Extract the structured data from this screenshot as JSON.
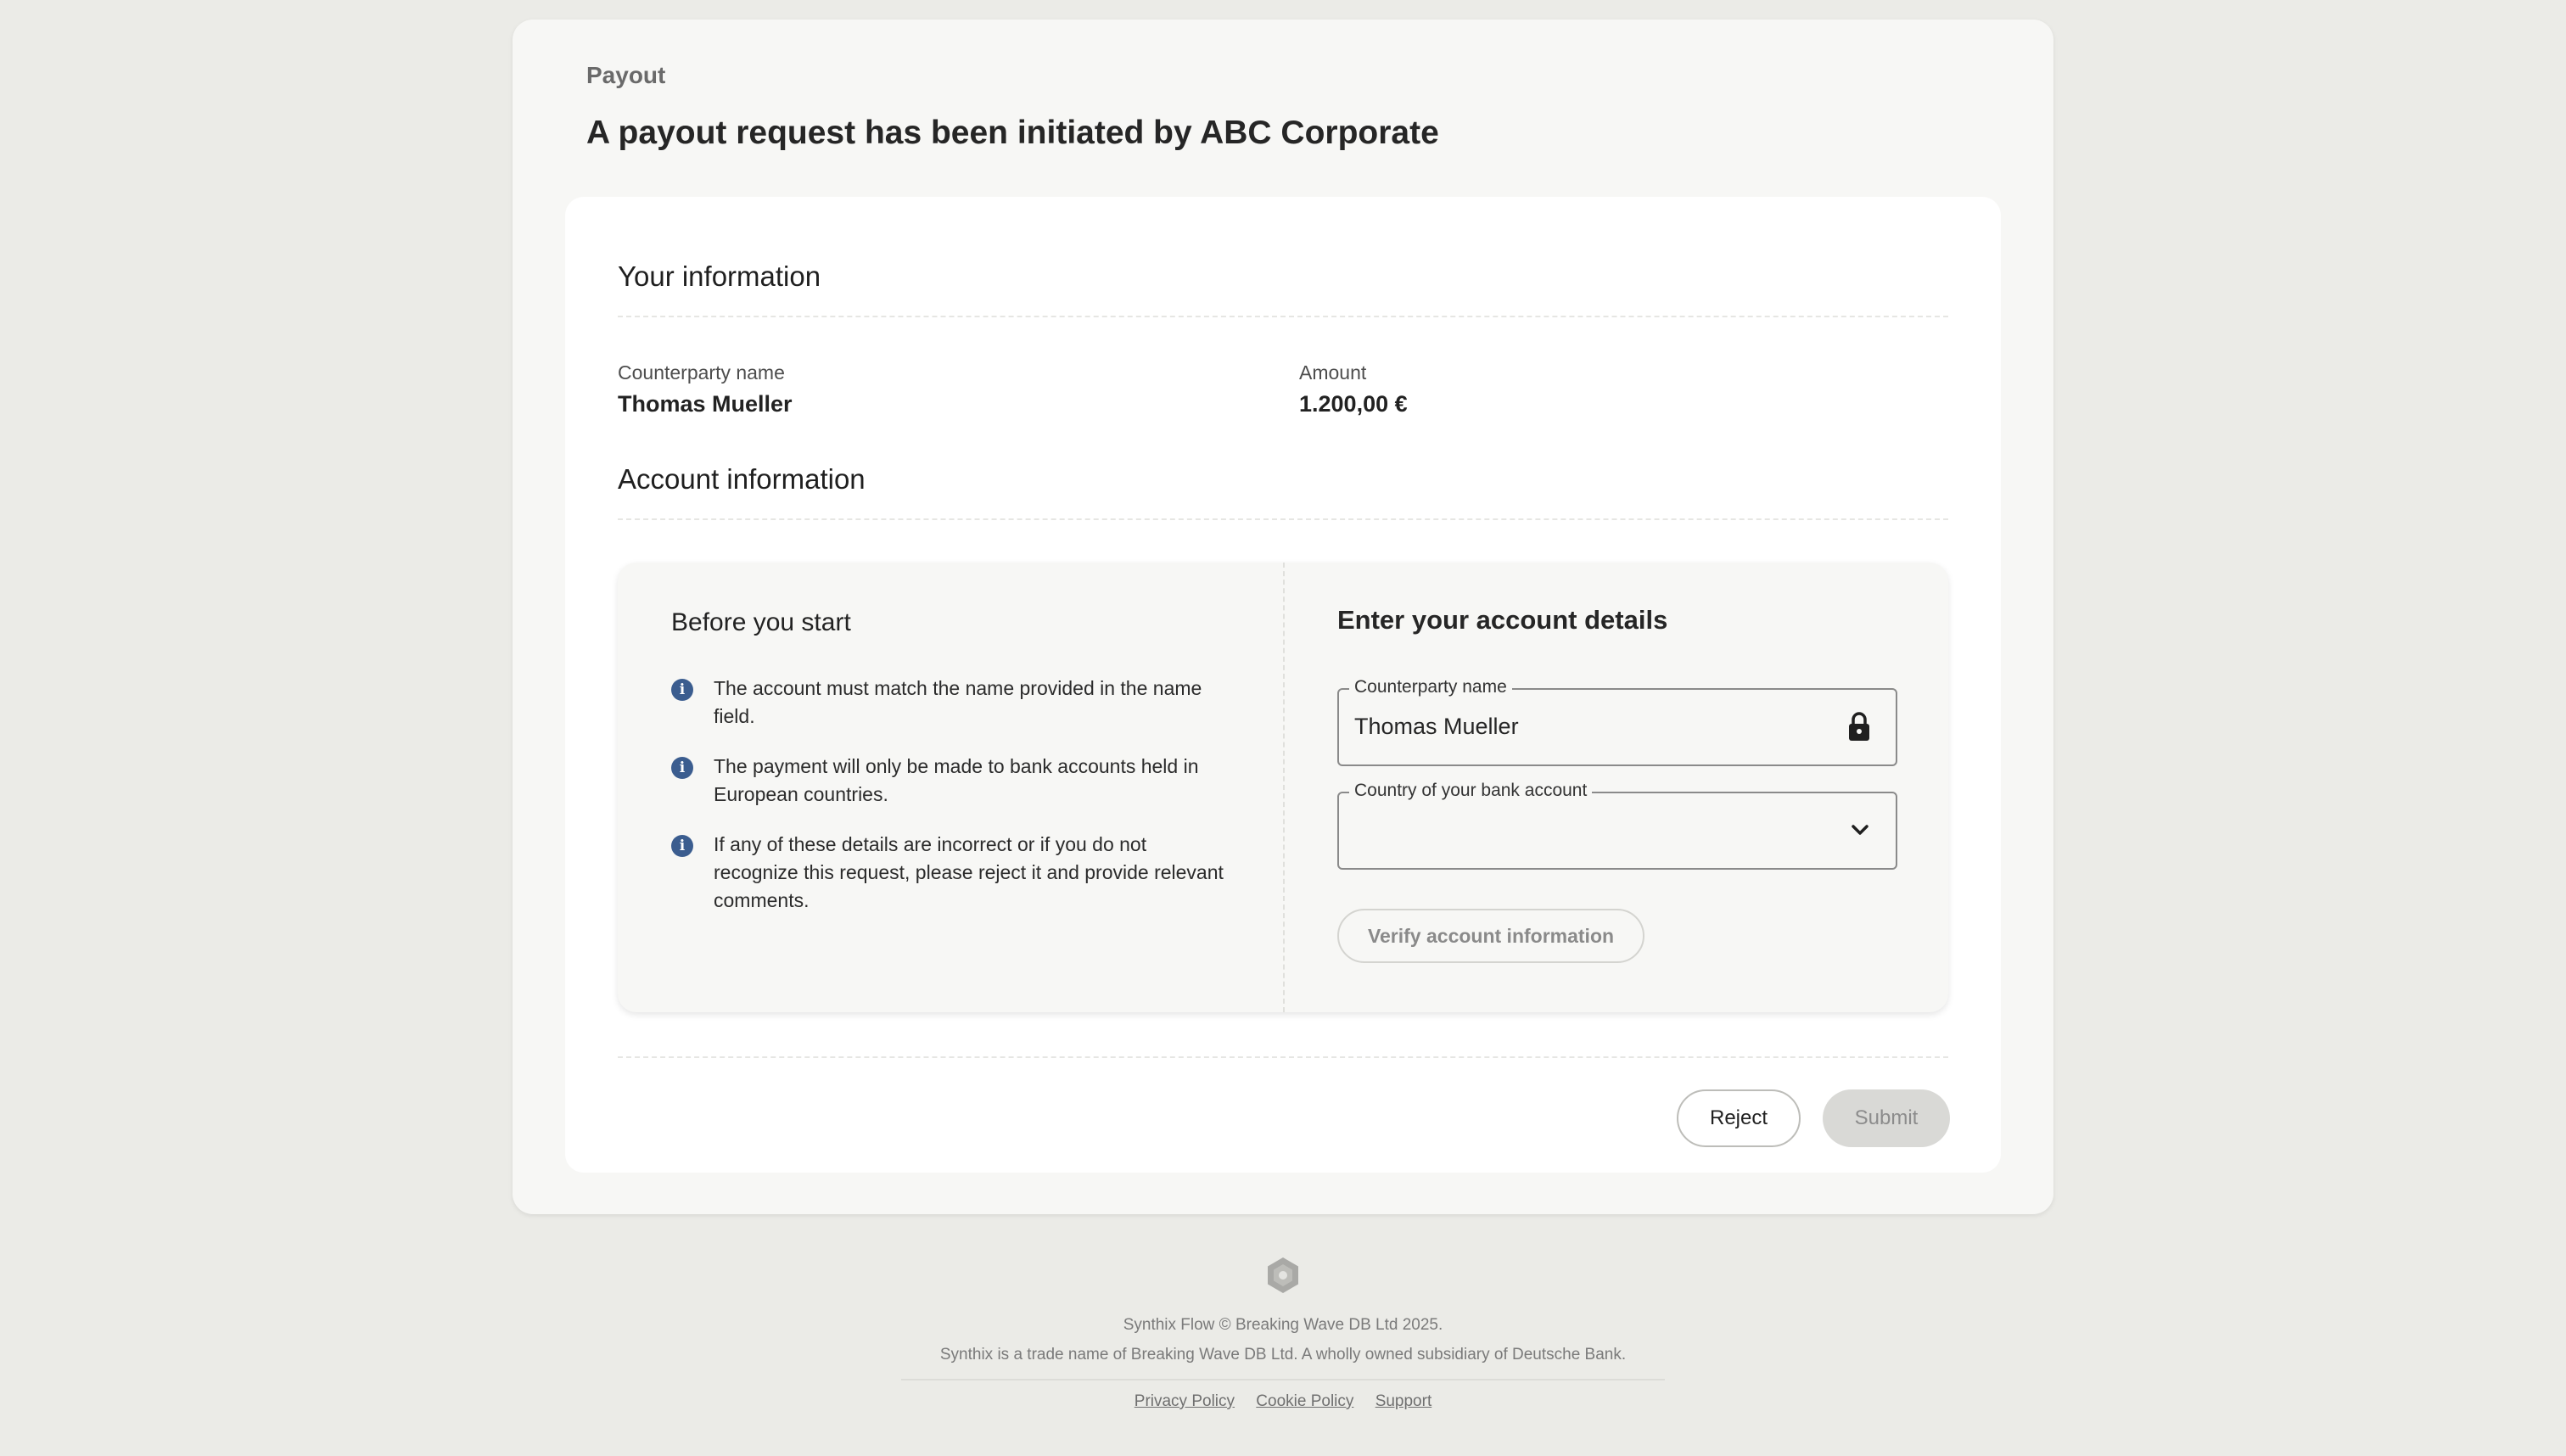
{
  "header": {
    "eyebrow": "Payout",
    "title": "A payout request has been initiated by ABC Corporate"
  },
  "your_information": {
    "title": "Your information",
    "counterparty_label": "Counterparty name",
    "counterparty_value": "Thomas Mueller",
    "amount_label": "Amount",
    "amount_value": "1.200,00 €"
  },
  "account_information": {
    "title": "Account information",
    "before_you_start": {
      "title": "Before you start",
      "items": [
        "The account must match the name provided in the name field.",
        "The payment will only be made to bank accounts held in European countries.",
        "If any of these details are incorrect or if you do not recognize this request, please reject it and provide relevant comments."
      ]
    },
    "form": {
      "title": "Enter your account details",
      "counterparty_label": "Counterparty name",
      "counterparty_value": "Thomas Mueller",
      "country_label": "Country of your bank account",
      "country_value": "",
      "verify_label": "Verify account information"
    }
  },
  "actions": {
    "reject_label": "Reject",
    "submit_label": "Submit"
  },
  "footer": {
    "copyright": "Synthix Flow © Breaking Wave DB Ltd 2025.",
    "legal": "Synthix is a trade name of Breaking Wave DB Ltd. A wholly owned subsidiary of Deutsche Bank.",
    "links": [
      "Privacy Policy",
      "Cookie Policy",
      "Support"
    ]
  },
  "icons": {
    "info": "info-circle-icon",
    "lock": "lock-icon",
    "chevron": "chevron-down-icon",
    "logo": "hexagon-logo-icon"
  },
  "colors": {
    "page_background": "#ebebe7",
    "info_icon": "#3b5d8f",
    "submit_disabled": "#d9d9d6"
  }
}
